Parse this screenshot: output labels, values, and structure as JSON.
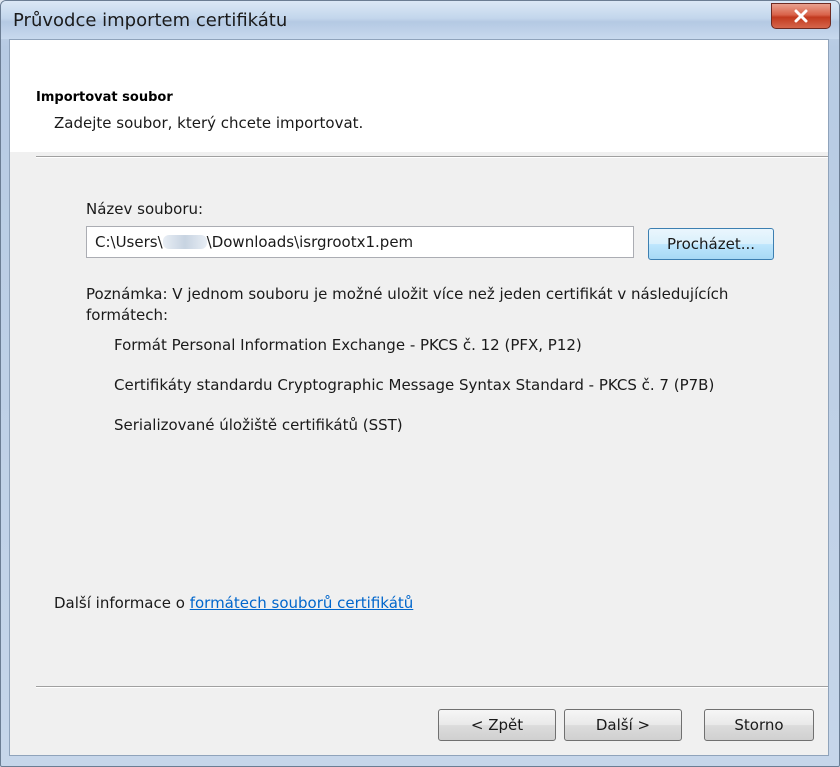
{
  "window": {
    "title": "Průvodce importem certifikátu",
    "close_label": "x"
  },
  "header": {
    "title": "Importovat soubor",
    "description": "Zadejte soubor, který chcete importovat."
  },
  "file": {
    "label": "Název souboru:",
    "path_prefix": "C:\\Users\\",
    "path_suffix": "\\Downloads\\isrgrootx1.pem",
    "browse_label": "Procházet..."
  },
  "note": {
    "text": "Poznámka: V jednom souboru je možné uložit více než jeden certifikát v následujících formátech:",
    "formats": [
      "Formát Personal Information Exchange - PKCS č. 12 (PFX, P12)",
      "Certifikáty standardu Cryptographic Message Syntax Standard - PKCS č. 7 (P7B)",
      "Serializované úložiště certifikátů (SST)"
    ]
  },
  "more_info": {
    "prefix": "Další informace o ",
    "link": "formátech souborů certifikátů"
  },
  "buttons": {
    "back": "< Zpět",
    "next": "Další >",
    "cancel": "Storno"
  },
  "colors": {
    "link": "#0066cc",
    "close_button": "#c23a1f",
    "dialog_background": "#f0f0f0"
  }
}
